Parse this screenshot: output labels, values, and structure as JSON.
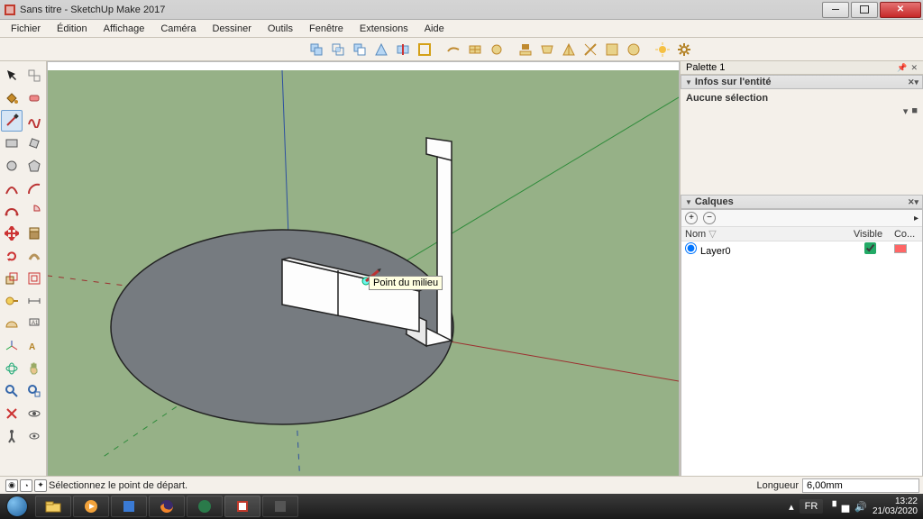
{
  "window": {
    "title": "Sans titre - SketchUp Make 2017"
  },
  "menu": {
    "items": [
      "Fichier",
      "Édition",
      "Affichage",
      "Caméra",
      "Dessiner",
      "Outils",
      "Fenêtre",
      "Extensions",
      "Aide"
    ]
  },
  "tooltip": {
    "text": "Point du milieu"
  },
  "palette": {
    "tab": "Palette 1",
    "entity_section": "Infos sur l'entité",
    "entity_status": "Aucune sélection",
    "layers_section": "Calques",
    "layers_columns": {
      "name": "Nom",
      "visible": "Visible",
      "color": "Co..."
    },
    "layers": [
      {
        "name": "Layer0",
        "visible": true,
        "color": "#ff6b6b",
        "active": true
      }
    ]
  },
  "status": {
    "hint": "Sélectionnez le point de départ.",
    "measure_label": "Longueur",
    "measure_value": "6,00mm"
  },
  "taskbar": {
    "lang": "FR",
    "time": "13:22",
    "date": "21/03/2020"
  }
}
